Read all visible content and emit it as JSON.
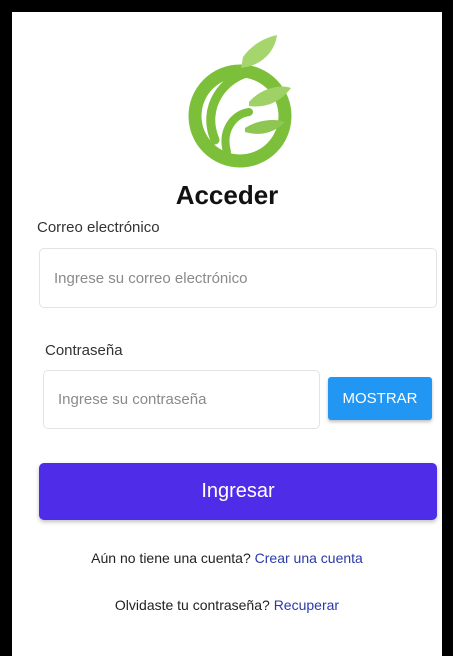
{
  "logo": {
    "icon": "leaf-circle-logo-icon",
    "color": "#7cbf3a"
  },
  "title": "Acceder",
  "email": {
    "label": "Correo electrónico",
    "placeholder": "Ingrese su correo electrónico",
    "value": ""
  },
  "password": {
    "label": "Contraseña",
    "placeholder": "Ingrese su contraseña",
    "value": "",
    "show_label": "MOSTRAR"
  },
  "submit_label": "Ingresar",
  "register": {
    "text": "Aún no tiene una cuenta?",
    "link": "Crear una cuenta"
  },
  "recover": {
    "text": "Olvidaste tu contraseña?",
    "link": "Recuperar"
  },
  "colors": {
    "primary": "#4e2ce8",
    "show_button": "#2196f3",
    "link": "#2a3aa8",
    "logo_green": "#7cbf3a"
  }
}
